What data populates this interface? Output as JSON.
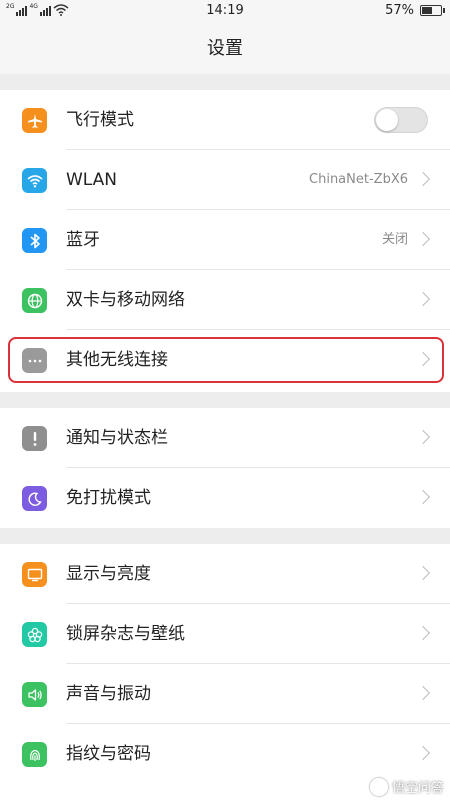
{
  "status_bar": {
    "signal1_tag": "2G",
    "signal2_tag": "4G",
    "time": "14:19",
    "battery_text": "57%",
    "battery_level": 0.57
  },
  "header": {
    "title": "设置"
  },
  "sections": [
    {
      "items": [
        {
          "label": "飞行模式",
          "icon": "airplane-icon",
          "color": "#f5901e",
          "control": "toggle",
          "toggle_on": false
        },
        {
          "label": "WLAN",
          "icon": "wifi-icon",
          "color": "#27a7e8",
          "value": "ChinaNet-ZbX6"
        },
        {
          "label": "蓝牙",
          "icon": "bluetooth-icon",
          "color": "#2196f3",
          "value": "关闭"
        },
        {
          "label": "双卡与移动网络",
          "icon": "globe-icon",
          "color": "#3cc261"
        },
        {
          "label": "其他无线连接",
          "icon": "more-icon",
          "color": "#9a9a9a"
        }
      ]
    },
    {
      "items": [
        {
          "label": "通知与状态栏",
          "icon": "exclamation-icon",
          "color": "#8f8f8f"
        },
        {
          "label": "免打扰模式",
          "icon": "moon-icon",
          "color": "#7c5ce0"
        }
      ]
    },
    {
      "items": [
        {
          "label": "显示与亮度",
          "icon": "display-icon",
          "color": "#f5901e"
        },
        {
          "label": "锁屏杂志与壁纸",
          "icon": "flower-icon",
          "color": "#23c9a4"
        },
        {
          "label": "声音与振动",
          "icon": "speaker-icon",
          "color": "#3cc261"
        },
        {
          "label": "指纹与密码",
          "icon": "fingerprint-icon",
          "color": "#3cc261"
        }
      ]
    }
  ],
  "watermark": {
    "text": "悟空问答"
  }
}
